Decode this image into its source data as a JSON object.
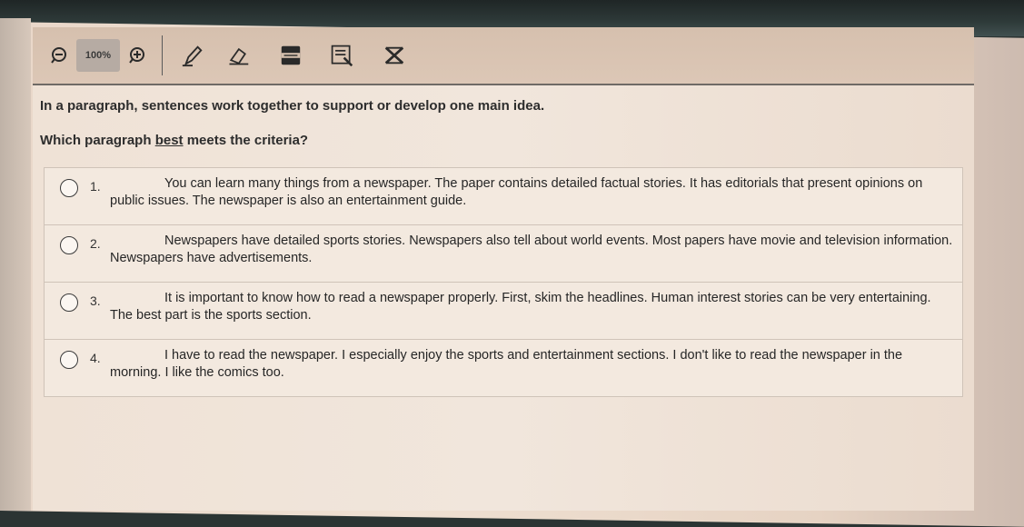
{
  "toolbar": {
    "zoom_out_icon": "zoom-out-icon",
    "zoom_level": "100%",
    "zoom_in_icon": "zoom-in-icon",
    "tools": [
      "pen-icon",
      "eraser-icon",
      "line-reader-icon",
      "notepad-icon",
      "answer-eliminator-icon"
    ]
  },
  "question": {
    "prompt": "In a paragraph, sentences work together to support or develop one main idea.",
    "stem_before": "Which paragraph ",
    "stem_emphasis": "best",
    "stem_after": " meets the criteria?"
  },
  "answers": [
    {
      "number": "1.",
      "text": "You can learn many things from a newspaper. The paper contains detailed factual stories. It has editorials that present opinions on public issues. The newspaper is also an entertainment guide."
    },
    {
      "number": "2.",
      "text": "Newspapers have detailed sports stories. Newspapers also tell about world events. Most papers have movie and television information. Newspapers have advertisements."
    },
    {
      "number": "3.",
      "text": "It is important to know how to read a newspaper properly. First, skim the headlines. Human interest stories can be very entertaining. The best part is the sports section."
    },
    {
      "number": "4.",
      "text": "I have to read the newspaper. I especially enjoy the sports and entertainment sections. I don't like to read the newspaper in the morning. I like the comics too."
    }
  ]
}
